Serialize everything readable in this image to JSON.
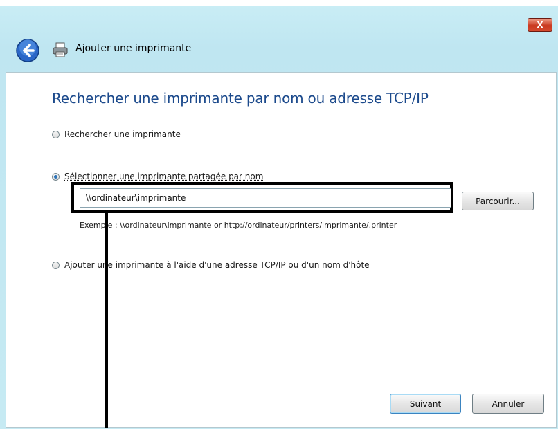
{
  "window": {
    "title": "Ajouter une imprimante",
    "close_label": "X"
  },
  "main": {
    "heading": "Rechercher une imprimante par nom ou adresse TCP/IP",
    "options": [
      {
        "label": "Rechercher une imprimante",
        "checked": false
      },
      {
        "label": "Sélectionner une imprimante partagée par nom",
        "checked": true
      },
      {
        "label": "Ajouter une imprimante à l'aide d'une adresse TCP/IP ou d'un nom d'hôte",
        "checked": false
      }
    ],
    "share_name_value": "\\\\ordinateur\\imprimante",
    "browse_label": "Parcourir...",
    "example_text": "Exemple : \\\\ordinateur\\imprimante or http://ordinateur/printers/imprimante/.printer"
  },
  "footer": {
    "next_label": "Suivant",
    "cancel_label": "Annuler"
  }
}
